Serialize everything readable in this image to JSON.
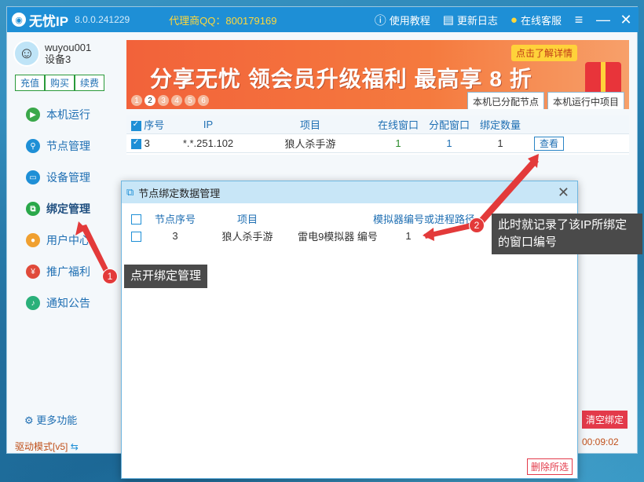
{
  "titlebar": {
    "app_name": "无忧IP",
    "version": "8.0.0.241229",
    "agent_qq": "代理商QQ：800179169",
    "tutorial": "使用教程",
    "changelog": "更新日志",
    "service": "在线客服"
  },
  "user": {
    "name": "wuyou001",
    "device": "设备3",
    "recharge": "充值",
    "buy": "购买",
    "renew": "续费"
  },
  "sidebar": {
    "items": [
      {
        "label": "本机运行",
        "icon": "play-icon",
        "color": "#3aa84a"
      },
      {
        "label": "节点管理",
        "icon": "tree-icon",
        "color": "#1e8fd6"
      },
      {
        "label": "设备管理",
        "icon": "device-icon",
        "color": "#1e8fd6"
      },
      {
        "label": "绑定管理",
        "icon": "bind-icon",
        "color": "#2aa84a"
      },
      {
        "label": "用户中心",
        "icon": "user-icon",
        "color": "#f0a030"
      },
      {
        "label": "推广福利",
        "icon": "gift-icon",
        "color": "#e04a3a"
      },
      {
        "label": "通知公告",
        "icon": "bell-icon",
        "color": "#2ab07a"
      }
    ],
    "more": "更多功能",
    "drive_mode": "驱动模式[v5]"
  },
  "banner": {
    "text": "分享无忧 领会员升级福利 最高享 8 折",
    "cta": "点击了解详情",
    "pages": [
      "1",
      "2",
      "3",
      "4",
      "5",
      "6"
    ],
    "active_page": "2"
  },
  "tabs": {
    "assigned": "本机已分配节点",
    "running": "本机运行中项目"
  },
  "table": {
    "headers": {
      "seq": "序号",
      "ip": "IP",
      "project": "项目",
      "online": "在线窗口",
      "assigned": "分配窗口",
      "bind": "绑定数量"
    },
    "rows": [
      {
        "seq": "3",
        "ip": "*.*.251.102",
        "project": "狼人杀手游",
        "online": "1",
        "assigned": "1",
        "bind": "1",
        "action": "查看"
      }
    ]
  },
  "clear_bind": "清空绑定",
  "timer": "00:09:02",
  "dialog": {
    "title": "节点绑定数据管理",
    "headers": {
      "seq": "节点序号",
      "project": "项目",
      "emu": "模拟器编号或进程路径"
    },
    "rows": [
      {
        "seq": "3",
        "project": "狼人杀手游",
        "emu_name": "雷电9模拟器 编号",
        "emu_no": "1"
      }
    ],
    "delete": "删除所选"
  },
  "callouts": {
    "one": "点开绑定管理",
    "two": "此时就记录了该IP所绑定的窗口编号",
    "badge_one": "1",
    "badge_two": "2"
  }
}
